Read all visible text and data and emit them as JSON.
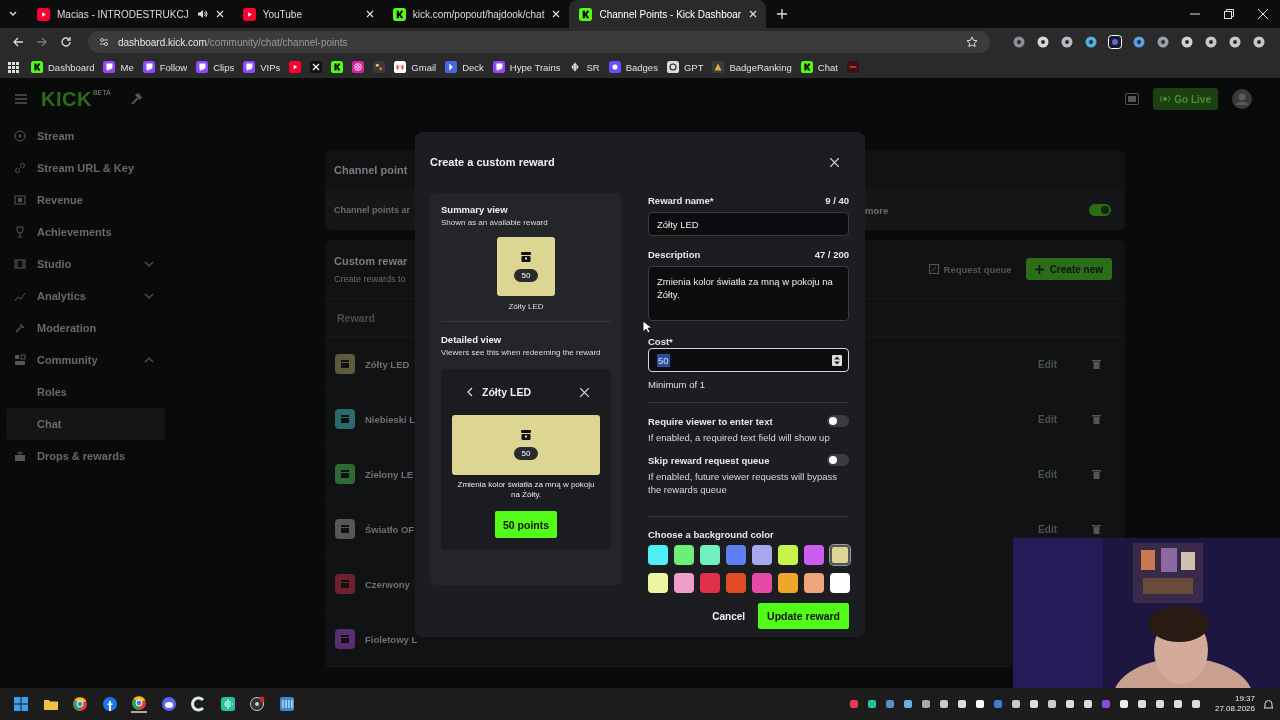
{
  "browser": {
    "tabs": [
      {
        "title": "Macias - INTRODESTRUKCJ",
        "kind": "youtube",
        "audio": true,
        "selected": false
      },
      {
        "title": "YouTube",
        "kind": "youtube",
        "audio": false,
        "selected": false
      },
      {
        "title": "kick.com/popout/hajdook/chat",
        "kind": "kick",
        "audio": false,
        "selected": false
      },
      {
        "title": "Channel Points - Kick Dashboar",
        "kind": "kick",
        "audio": false,
        "selected": true
      }
    ],
    "url_host": "dashboard.kick.com",
    "url_path": "/community/chat/channel-points",
    "bookmarks": [
      {
        "label": "Dashboard",
        "kind": "kick"
      },
      {
        "label": "Me",
        "kind": "twitch"
      },
      {
        "label": "Follow",
        "kind": "twitch"
      },
      {
        "label": "Clips",
        "kind": "twitch"
      },
      {
        "label": "VIPs",
        "kind": "twitch"
      },
      {
        "kind": "youtube"
      },
      {
        "kind": "x"
      },
      {
        "kind": "kick"
      },
      {
        "kind": "instagram"
      },
      {
        "kind": "misc"
      },
      {
        "label": "Gmail",
        "kind": "gmail"
      },
      {
        "label": "Deck",
        "kind": "deck"
      },
      {
        "label": "Hype Trains",
        "kind": "twitch"
      },
      {
        "label": "SR",
        "kind": "sr"
      },
      {
        "label": "Badges",
        "kind": "badges"
      },
      {
        "label": "GPT",
        "kind": "gpt"
      },
      {
        "label": "BadgeRanking",
        "kind": "ranking"
      },
      {
        "label": "Chat",
        "kind": "kick"
      },
      {
        "kind": "red"
      }
    ]
  },
  "header": {
    "logo": "KICK",
    "logo_tag": "BETA",
    "go_live": "Go Live"
  },
  "sidebar": {
    "items": [
      {
        "label": "Stream",
        "kind": "link"
      },
      {
        "label": "Stream URL & Key",
        "kind": "link"
      },
      {
        "label": "Revenue",
        "kind": "link"
      },
      {
        "label": "Achievements",
        "kind": "link"
      },
      {
        "label": "Studio",
        "kind": "group",
        "expanded": false
      },
      {
        "label": "Analytics",
        "kind": "group",
        "expanded": false
      },
      {
        "label": "Moderation",
        "kind": "link"
      },
      {
        "label": "Community",
        "kind": "group",
        "expanded": true,
        "children": [
          {
            "label": "Roles",
            "selected": false
          },
          {
            "label": "Chat",
            "selected": true
          }
        ]
      },
      {
        "label": "Drops & rewards",
        "kind": "link"
      }
    ]
  },
  "main": {
    "points_card": {
      "title": "Channel point",
      "text": "Channel points ar",
      "text_more": "more",
      "enabled": true
    },
    "rewards_card": {
      "title": "Custom rewar",
      "subtitle": "Create rewards to",
      "request_queue": "Request queue",
      "create_new": "Create new",
      "column_1": "Reward",
      "rows": [
        {
          "name": "Zółty LED",
          "color": "#5e5a3c",
          "action": "Edit"
        },
        {
          "name": "Niebieski L",
          "color": "#2a6a6e",
          "action": "Edit"
        },
        {
          "name": "Zielony LE",
          "color": "#2f6a35",
          "action": "Edit"
        },
        {
          "name": "Światło OF",
          "color": "#555758",
          "action": "Edit"
        },
        {
          "name": "Czerwony",
          "color": "#6e2230"
        },
        {
          "name": "Fioletowy L",
          "color": "#5a2f70"
        }
      ]
    }
  },
  "modal": {
    "title": "Create a custom reward",
    "summary": {
      "heading": "Summary view",
      "subheading": "Shown as an available reward",
      "cost": "50",
      "name": "Zółty LED"
    },
    "detailed": {
      "heading": "Detailed view",
      "subheading": "Viewers see this when redeeming the reward",
      "title": "Zółty LED",
      "cost": "50",
      "description": "Zmienia kolor światła za mną w pokoju na Żółty.",
      "button": "50 points"
    },
    "reward_name": {
      "label": "Reward name*",
      "counter": "9 / 40",
      "value": "Zółty LED"
    },
    "description": {
      "label": "Description",
      "counter": "47 / 200",
      "value": "Zmienia kolor światła za mną w pokoju na Żółty."
    },
    "cost": {
      "label": "Cost*",
      "value": "50",
      "value_selected": true,
      "hint": "Minimum of 1"
    },
    "toggles": [
      {
        "label": "Require viewer to enter text",
        "help": "If enabled, a required text field will show up",
        "on": false
      },
      {
        "label": "Skip reward request queue",
        "help": "If enabled, future viewer requests will bypass the rewards queue",
        "on": false
      }
    ],
    "color_label": "Choose a background color",
    "colors": [
      {
        "color": "#4ef0f6",
        "selected": false
      },
      {
        "color": "#6cee78",
        "selected": false
      },
      {
        "color": "#70efc0",
        "selected": false
      },
      {
        "color": "#5d7ff0",
        "selected": false
      },
      {
        "color": "#a9a7ef",
        "selected": false
      },
      {
        "color": "#c9f44c",
        "selected": false
      },
      {
        "color": "#cb5df0",
        "selected": false
      },
      {
        "color": "#ddd592",
        "selected": true
      },
      {
        "color": "#eef5a2",
        "selected": false
      },
      {
        "color": "#ee9fc9",
        "selected": false
      },
      {
        "color": "#e0304a",
        "selected": false
      },
      {
        "color": "#e24b25",
        "selected": false
      },
      {
        "color": "#e34ba7",
        "selected": false
      },
      {
        "color": "#f0a52b",
        "selected": false
      },
      {
        "color": "#efa579",
        "selected": false
      },
      {
        "color": "#ffffff",
        "selected": false
      }
    ],
    "cancel": "Cancel",
    "submit": "Update reward"
  },
  "taskbar": {
    "time": "19:37",
    "date": "27.08.2026"
  }
}
